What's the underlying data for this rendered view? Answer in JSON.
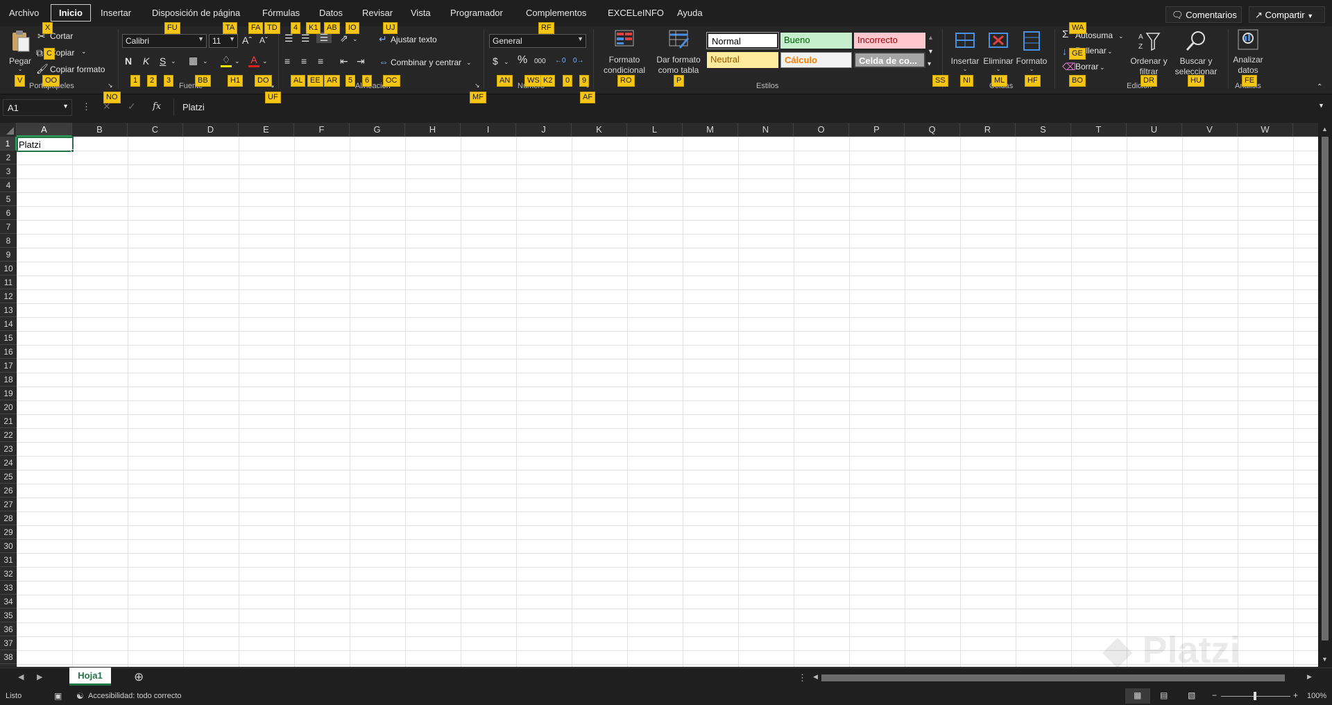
{
  "tabs": [
    "Archivo",
    "Inicio",
    "Insertar",
    "Disposición de página",
    "Fórmulas",
    "Datos",
    "Revisar",
    "Vista",
    "Programador",
    "Complementos",
    "EXCELeINFO",
    "Ayuda"
  ],
  "topbar": {
    "comments": "Comentarios",
    "share": "Compartir"
  },
  "ribbon": {
    "clipboard": {
      "paste": "Pegar",
      "cut": "Cortar",
      "copy": "Copiar",
      "format_painter": "Copiar formato",
      "group": "Portapapeles"
    },
    "font": {
      "name": "Calibri",
      "size": "11",
      "bold": "N",
      "italic": "K",
      "underline": "S",
      "group": "Fuente"
    },
    "alignment": {
      "wrap": "Ajustar texto",
      "merge": "Combinar y centrar",
      "group": "Alineación"
    },
    "number": {
      "format": "General",
      "group": "Número"
    },
    "styles": {
      "conditional": "Formato condicional",
      "as_table": "Dar formato como tabla",
      "cells": [
        "Normal",
        "Bueno",
        "Incorrecto",
        "Neutral",
        "Cálculo",
        "Celda de co..."
      ],
      "group": "Estilos"
    },
    "cells": {
      "insert": "Insertar",
      "delete": "Eliminar",
      "format": "Formato",
      "group": "Celdas"
    },
    "editing": {
      "autosum": "Autosuma",
      "fill": "Rellenar",
      "clear": "Borrar",
      "sort": "Ordenar y filtrar",
      "find": "Buscar y seleccionar",
      "group": "Edición"
    },
    "analysis": {
      "analyze": "Analizar datos",
      "group": "Análisis"
    }
  },
  "keytips": {
    "x": "X",
    "c": "C",
    "v": "V",
    "oo": "OO",
    "no": "NO",
    "fu": "FU",
    "ta": "TA",
    "fa": "FA",
    "td": "TD",
    "k4": "4",
    "k1": "K1",
    "ab": "AB",
    "io": "IO",
    "uj": "UJ",
    "rf": "RF",
    "n1": "1",
    "n2": "2",
    "n3": "3",
    "bb": "BB",
    "h1": "H1",
    "do": "DO",
    "uf": "UF",
    "al": "AL",
    "ee": "EE",
    "ar": "AR",
    "n5": "5",
    "n6": "6",
    "oc": "OC",
    "mf": "MF",
    "an": "AN",
    "ws": "WS",
    "k2": "K2",
    "n0": "0",
    "n9": "9",
    "af": "AF",
    "ro": "RO",
    "p": "P",
    "ss": "SS",
    "ni": "NI",
    "ml": "ML",
    "hf": "HF",
    "wa": "WA",
    "ge": "GE",
    "bo": "BO",
    "dr": "DR",
    "hu": "HU",
    "fe": "FE"
  },
  "formula_bar": {
    "name_box": "A1",
    "fx": "fx",
    "content": "Platzi"
  },
  "columns": [
    "A",
    "B",
    "C",
    "D",
    "E",
    "F",
    "G",
    "H",
    "I",
    "J",
    "K",
    "L",
    "M",
    "N",
    "O",
    "P",
    "Q",
    "R",
    "S",
    "T",
    "U",
    "V",
    "W"
  ],
  "rows": [
    "1",
    "2",
    "3",
    "4",
    "5",
    "6",
    "7",
    "8",
    "9",
    "10",
    "11",
    "12",
    "13",
    "14",
    "15",
    "16",
    "17",
    "18",
    "19",
    "20",
    "21",
    "22",
    "23",
    "24",
    "25",
    "26",
    "27",
    "28",
    "29",
    "30",
    "31",
    "32",
    "33",
    "34",
    "35",
    "36",
    "37",
    "38"
  ],
  "cell_a1": "Platzi",
  "sheet_tab": "Hoja1",
  "status": {
    "ready": "Listo",
    "accessibility": "Accesibilidad: todo correcto",
    "zoom": "100%"
  },
  "colors": {
    "accent": "#217346",
    "keytip": "#f5c518",
    "ribbon_bg": "#262626"
  }
}
